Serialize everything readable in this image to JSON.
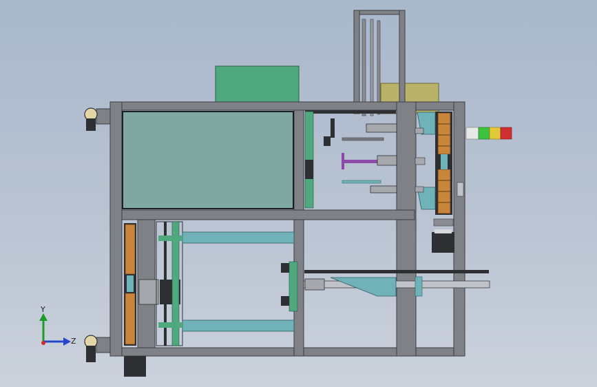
{
  "viewport": {
    "background": "gradient-grey-blue",
    "colors": {
      "frame": "#7f8187",
      "frame_dark": "#3b3d42",
      "panel_window": "#7fa8a2",
      "electrical_box": "#4fa87e",
      "motor_box": "#b9b36a",
      "cylinder_teal": "#6fb3b8",
      "block_orange": "#c9853c",
      "rail_dark": "#2e2f33",
      "signal_white": "#e8e8e8",
      "signal_green": "#3cc23c",
      "signal_yellow": "#e3c83a",
      "signal_red": "#d0302f"
    }
  },
  "signal_tower": {
    "segments": [
      "white",
      "green",
      "yellow",
      "red"
    ]
  },
  "triad": {
    "y_label": "Y",
    "z_label": "Z",
    "x_color": "#d02a2a",
    "y_color": "#1f9b2b",
    "z_color": "#2747c9"
  }
}
